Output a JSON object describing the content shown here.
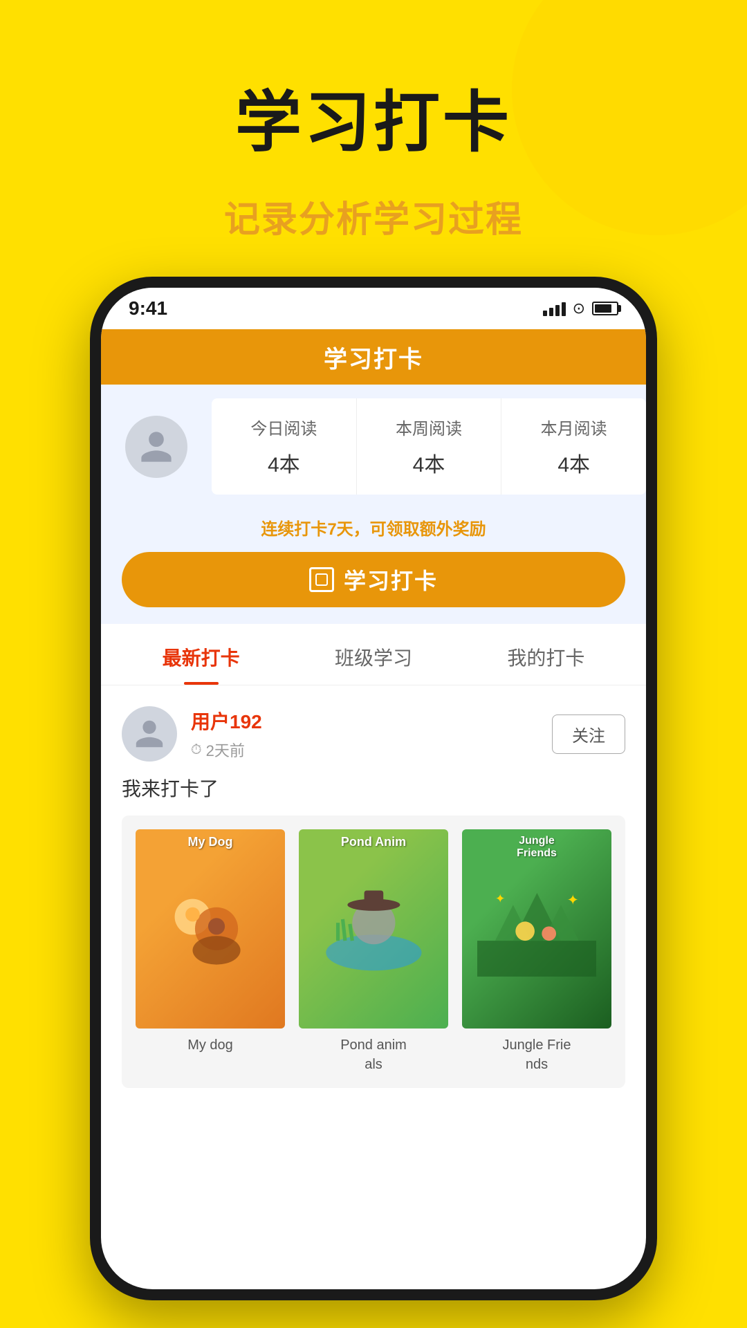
{
  "page": {
    "background_color": "#FFE000",
    "main_title": "学习打卡",
    "sub_title": "记录分析学习过程"
  },
  "status_bar": {
    "time": "9:41"
  },
  "app_header": {
    "title": "学习打卡"
  },
  "stats": {
    "today_label": "今日阅读",
    "today_value": "4本",
    "week_label": "本周阅读",
    "week_value": "4本",
    "month_label": "本月阅读",
    "month_value": "4本"
  },
  "checkin": {
    "notice_text": "连续打卡",
    "notice_days": "7",
    "notice_suffix": "天，可领取额外奖励",
    "btn_label": "学习打卡"
  },
  "tabs": [
    {
      "label": "最新打卡",
      "active": true
    },
    {
      "label": "班级学习",
      "active": false
    },
    {
      "label": "我的打卡",
      "active": false
    }
  ],
  "feed": {
    "user": {
      "name": "用户192",
      "time": "2天前",
      "follow_label": "关注"
    },
    "message": "我来打卡了",
    "books": [
      {
        "title": "My Dog",
        "caption": "My dog"
      },
      {
        "title": "Pond Anim",
        "caption": "Pond anim\nals"
      },
      {
        "title": "Jungle Friends",
        "caption": "Jungle Frie\nnds"
      }
    ]
  }
}
